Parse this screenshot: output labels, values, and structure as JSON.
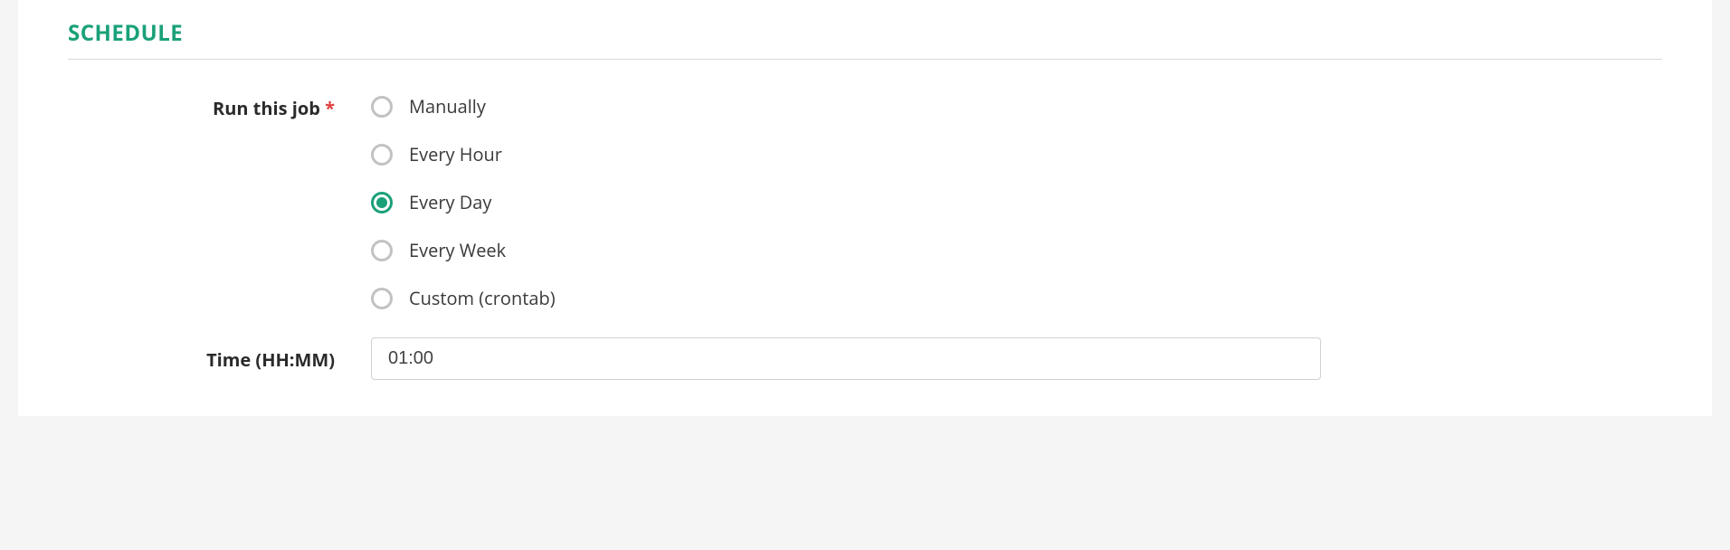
{
  "section": {
    "title": "SCHEDULE"
  },
  "runJob": {
    "label": "Run this job",
    "required": "*",
    "options": [
      {
        "label": "Manually",
        "selected": false
      },
      {
        "label": "Every Hour",
        "selected": false
      },
      {
        "label": "Every Day",
        "selected": true
      },
      {
        "label": "Every Week",
        "selected": false
      },
      {
        "label": "Custom (crontab)",
        "selected": false
      }
    ]
  },
  "time": {
    "label": "Time (HH:MM)",
    "value": "01:00"
  }
}
